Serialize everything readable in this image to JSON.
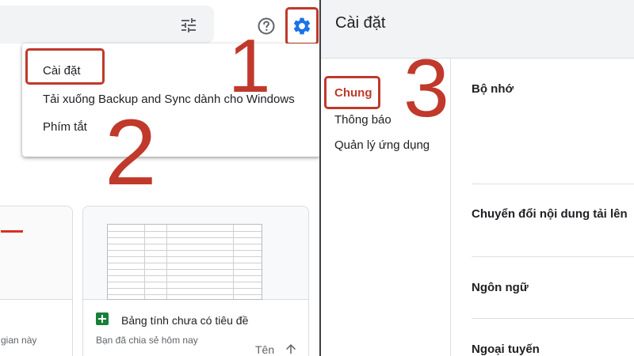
{
  "topbar": {
    "icons": [
      "tune-icon",
      "help-icon",
      "gear-icon"
    ]
  },
  "menu": {
    "items": [
      "Cài đặt",
      "Tải xuống Backup and Sync dành cho Windows",
      "Phím tắt"
    ]
  },
  "steps": [
    "1",
    "2",
    "3"
  ],
  "cards": [
    {
      "subtitle": "gian này"
    },
    {
      "title": "Bảng tính chưa có tiêu đề",
      "subtitle": "Bạn đã chia sẻ hôm nay"
    }
  ],
  "sort": {
    "label": "Tên"
  },
  "settings": {
    "title": "Cài đặt",
    "nav": [
      "Chung",
      "Thông báo",
      "Quản lý ứng dụng"
    ],
    "active_nav": "Chung",
    "sections": [
      "Bộ nhớ",
      "Chuyển đổi nội dung tải lên",
      "Ngôn ngữ",
      "Ngoại tuyến"
    ]
  },
  "colors": {
    "highlight": "#c0392b",
    "sheets_green": "#188038",
    "header_bg": "#f1f3f4"
  }
}
